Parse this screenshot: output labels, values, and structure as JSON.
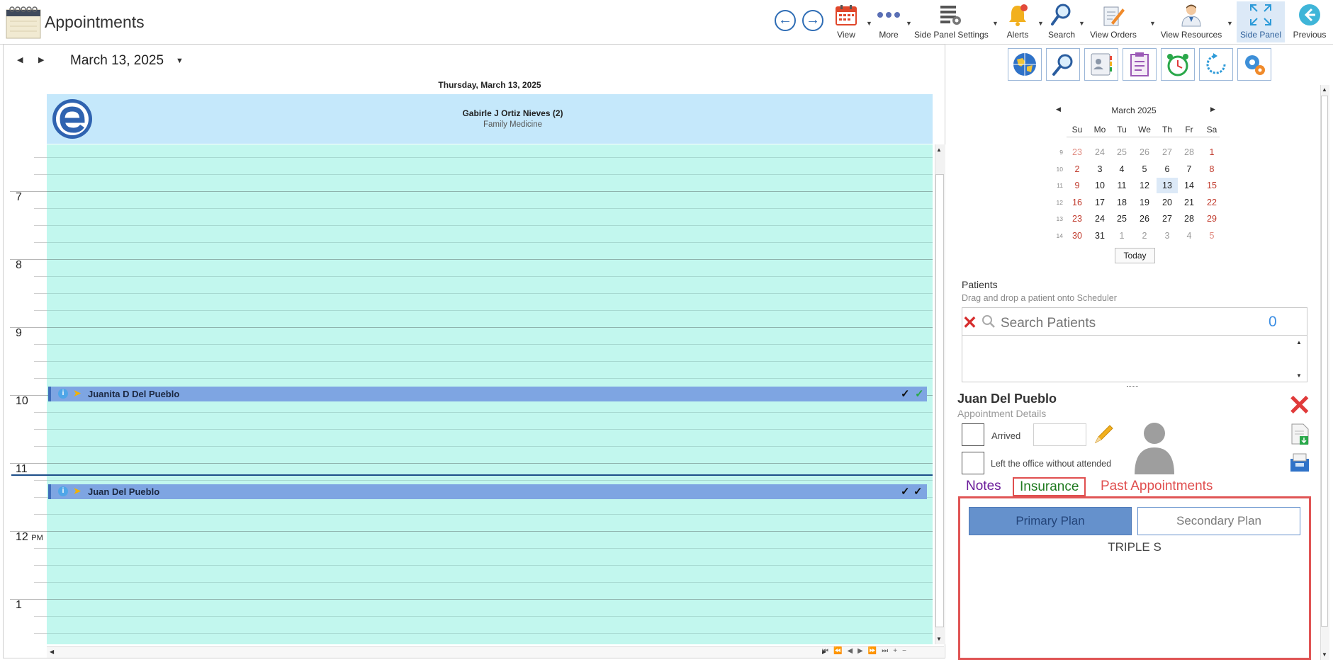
{
  "app": {
    "title": "Appointments",
    "toolbar": {
      "view": "View",
      "more": "More",
      "side_panel_settings": "Side Panel Settings",
      "alerts": "Alerts",
      "search": "Search",
      "view_orders": "View Orders",
      "view_resources": "View Resources",
      "side_panel": "Side Panel",
      "previous": "Previous"
    }
  },
  "scheduler": {
    "date_label": "March 13, 2025",
    "day_header": "Thursday, March 13, 2025",
    "resource": {
      "name": "Gabirle J Ortiz Nieves (2)",
      "specialty": "Family Medicine"
    },
    "hours": [
      "7",
      "8",
      "9",
      "10",
      "11",
      "12",
      "1"
    ],
    "pm_marker": "PM",
    "appointments": [
      {
        "patient": "Juanita D Del Pueblo",
        "info": "i"
      },
      {
        "patient": "Juan Del Pueblo",
        "info": "i"
      }
    ]
  },
  "mini_calendar": {
    "title": "March 2025",
    "day_headers": [
      "Su",
      "Mo",
      "Tu",
      "We",
      "Th",
      "Fr",
      "Sa"
    ],
    "weeks": [
      {
        "wk": "9",
        "days": [
          "23",
          "24",
          "25",
          "26",
          "27",
          "28",
          "1"
        ]
      },
      {
        "wk": "10",
        "days": [
          "2",
          "3",
          "4",
          "5",
          "6",
          "7",
          "8"
        ]
      },
      {
        "wk": "11",
        "days": [
          "9",
          "10",
          "11",
          "12",
          "13",
          "14",
          "15"
        ]
      },
      {
        "wk": "12",
        "days": [
          "16",
          "17",
          "18",
          "19",
          "20",
          "21",
          "22"
        ]
      },
      {
        "wk": "13",
        "days": [
          "23",
          "24",
          "25",
          "26",
          "27",
          "28",
          "29"
        ]
      },
      {
        "wk": "14",
        "days": [
          "30",
          "31",
          "1",
          "2",
          "3",
          "4",
          "5"
        ]
      }
    ],
    "selected_day": "13",
    "today_label": "Today"
  },
  "patients": {
    "title": "Patients",
    "hint": "Drag and drop a patient onto Scheduler",
    "search_placeholder": "Search Patients",
    "count": "0"
  },
  "appointment_details": {
    "patient_name": "Juan Del Pueblo",
    "subtitle": "Appointment Details",
    "arrived_label": "Arrived",
    "left_label": "Left the office without attended",
    "tabs": {
      "notes": "Notes",
      "insurance": "Insurance",
      "past": "Past Appointments"
    },
    "insurance": {
      "primary_label": "Primary Plan",
      "secondary_label": "Secondary Plan",
      "plan_name": "TRIPLE S"
    }
  },
  "colors": {
    "grid_background": "#c2f7ee",
    "appointment": "#7ea5e2",
    "resource_header": "#c5e8fb",
    "highlight_red": "#e05555",
    "primary_button": "#6591cc"
  }
}
